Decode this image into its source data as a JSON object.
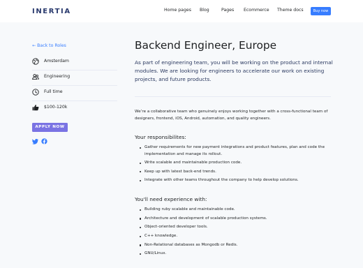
{
  "header": {
    "logo": "INERTIA",
    "nav": [
      "Home pages",
      "Blog",
      "Pages",
      "Ecommerce",
      "Theme docs"
    ],
    "buy_label": "Buy now"
  },
  "sidebar": {
    "back_label": "Back to Roles",
    "details": [
      {
        "icon": "globe-icon",
        "label": "Amsterdam"
      },
      {
        "icon": "users-icon",
        "label": "Engineering"
      },
      {
        "icon": "clock-icon",
        "label": "Full time"
      },
      {
        "icon": "thumbs-up-icon",
        "label": "$100-120k"
      }
    ],
    "apply_label": "APPLY NOW",
    "social": [
      "twitter-icon",
      "facebook-icon"
    ]
  },
  "job": {
    "title": "Backend Engineer, Europe",
    "lead": "As part of engineering team, you will be working on the product and internal modules. We are looking for engineers to accelerate our work on existing projects, and future products.",
    "intro": "We’re a collaborative team who genuinely enjoys working together with a cross-functional team of designers, frontend, iOS, Android, automation, and quality engineers.",
    "responsibilities_heading": "Your responsibilites:",
    "responsibilities": [
      "Gather requirements for new payment integrations and product features, plan and code the implementation and manage its rollout.",
      "Write scalable and maintainable production code.",
      "Keep up with latest back-end trends.",
      "Integrate with other teams throughout the company to help develop solutions."
    ],
    "experience_heading": "You'll need experience with:",
    "experience": [
      "Building ruby scalable and maintainable code.",
      "Architecture and development of scalable production systems.",
      "Object-oriented developer tools.",
      "C++ knowledge.",
      "Non-Relational databases as Mongodb or Redis.",
      "GNU/Linux."
    ]
  },
  "colors": {
    "accent": "#377dff",
    "apply": "#7a73e3",
    "logo": "#2a3a6e",
    "text": "#1e2022",
    "band": "#f7f9fb"
  }
}
